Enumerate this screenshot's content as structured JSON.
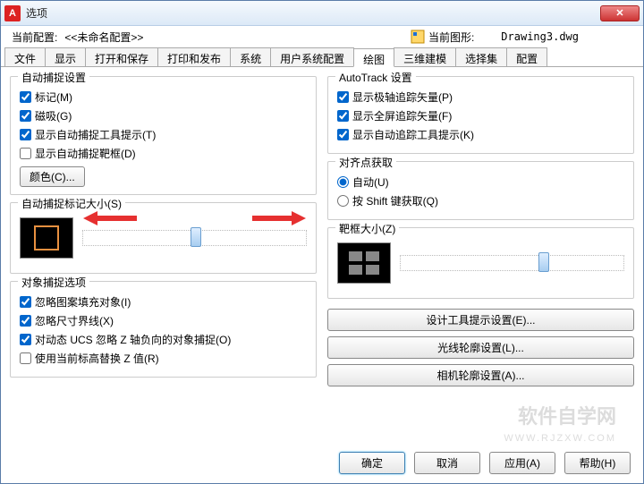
{
  "window": {
    "title": "选项"
  },
  "profile": {
    "label": "当前配置:",
    "name": "<<未命名配置>>",
    "drawing_label": "当前图形:",
    "drawing_name": "Drawing3.dwg"
  },
  "tabs": [
    "文件",
    "显示",
    "打开和保存",
    "打印和发布",
    "系统",
    "用户系统配置",
    "绘图",
    "三维建模",
    "选择集",
    "配置"
  ],
  "active_tab": "绘图",
  "left": {
    "autosnap": {
      "legend": "自动捕捉设置",
      "marker": "标记(M)",
      "magnet": "磁吸(G)",
      "tooltip": "显示自动捕捉工具提示(T)",
      "aperture_box": "显示自动捕捉靶框(D)",
      "color_btn": "颜色(C)..."
    },
    "marker_size": {
      "legend": "自动捕捉标记大小(S)"
    },
    "osnap_opts": {
      "legend": "对象捕捉选项",
      "ignore_hatch": "忽略图案填充对象(I)",
      "ignore_dim": "忽略尺寸界线(X)",
      "dyn_ucs": "对动态 UCS 忽略 Z 轴负向的对象捕捉(O)",
      "replace_z": "使用当前标高替换 Z 值(R)"
    }
  },
  "right": {
    "autotrack": {
      "legend": "AutoTrack 设置",
      "polar_vec": "显示极轴追踪矢量(P)",
      "full_vec": "显示全屏追踪矢量(F)",
      "track_tip": "显示自动追踪工具提示(K)"
    },
    "align": {
      "legend": "对齐点获取",
      "auto": "自动(U)",
      "shift": "按 Shift 键获取(Q)"
    },
    "aperture_size": {
      "legend": "靶框大小(Z)"
    },
    "btns": {
      "design_tip": "设计工具提示设置(E)...",
      "ray_outline": "光线轮廓设置(L)...",
      "cam_outline": "相机轮廓设置(A)..."
    }
  },
  "dlg": {
    "ok": "确定",
    "cancel": "取消",
    "apply": "应用(A)",
    "help": "帮助(H)"
  },
  "watermark": {
    "main": "软件自学网",
    "sub": "WWW.RJZXW.COM"
  }
}
